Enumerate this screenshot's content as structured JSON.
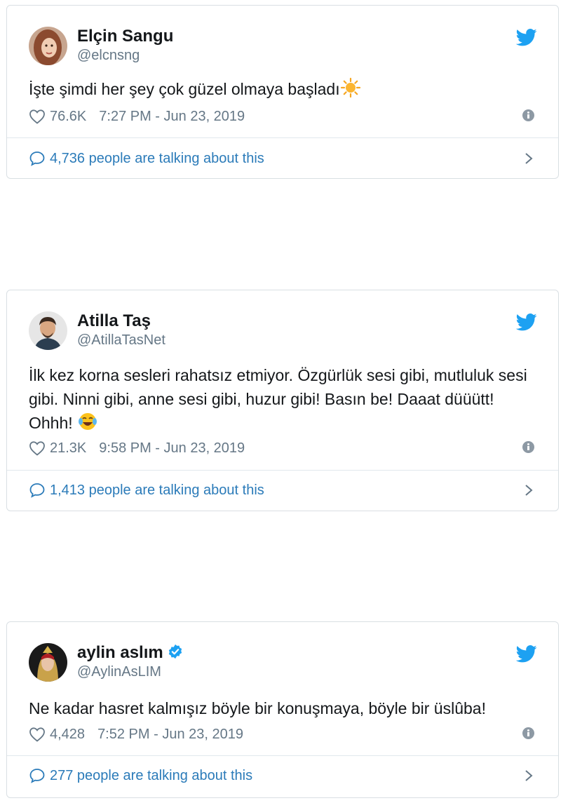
{
  "tweets": [
    {
      "name": "Elçin Sangu",
      "handle": "@elcnsng",
      "text": "İşte şimdi her şey çok güzel olmaya başladı",
      "emoji": "sun-emoji",
      "likes": "76.6K",
      "time": "7:27 PM - Jun 23, 2019",
      "talking": "4,736 people are talking about this"
    },
    {
      "name": "Atilla Taş",
      "handle": "@AtillaTasNet",
      "text": "İlk kez korna sesleri rahatsız etmiyor. Özgürlük sesi gibi, mutluluk sesi gibi. Ninni gibi, anne sesi gibi, huzur gibi! Basın be! Daaat düüütt! Ohhh!",
      "emoji": "tears-of-joy-emoji",
      "likes": "21.3K",
      "time": "9:58 PM - Jun 23, 2019",
      "talking": "1,413 people are talking about this"
    },
    {
      "name": "aylin aslım",
      "handle": "@AylinAsLIM",
      "verified": true,
      "text": "Ne kadar hasret kalmışız böyle bir konuşmaya, böyle bir üslûba!",
      "likes": "4,428",
      "time": "7:52 PM - Jun 23, 2019",
      "talking": "277 people are talking about this"
    }
  ],
  "colors": {
    "twitter_blue": "#1da1f2",
    "link_blue": "#2b7bb9",
    "muted": "#657786",
    "border": "#d9dfe3"
  }
}
